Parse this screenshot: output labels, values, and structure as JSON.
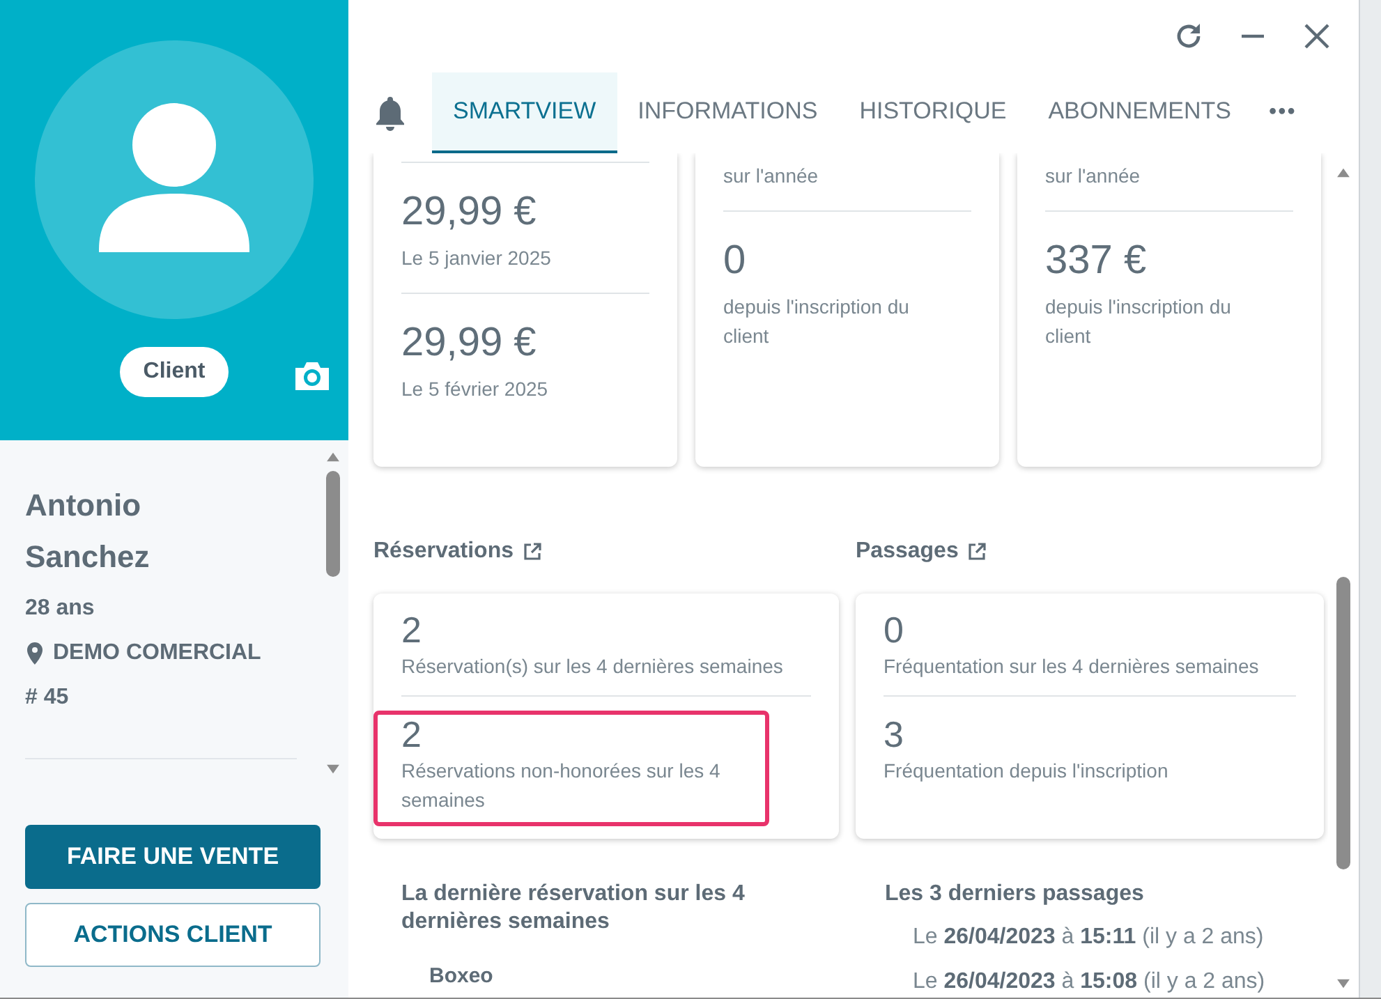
{
  "profile": {
    "badge": "Client",
    "first_name": "Antonio",
    "last_name": "Sanchez",
    "age": "28 ans",
    "location": "DEMO COMERCIAL",
    "number": "# 45"
  },
  "actions": [
    {
      "label": "FAIRE UNE VENTE",
      "kind": "primary"
    },
    {
      "label": "ACTIONS CLIENT",
      "kind": "outline"
    }
  ],
  "tabs": [
    {
      "label": "SMARTVIEW",
      "selected": true
    },
    {
      "label": "INFORMATIONS",
      "selected": false
    },
    {
      "label": "HISTORIQUE",
      "selected": false
    },
    {
      "label": "ABONNEMENTS",
      "selected": false
    }
  ],
  "more_tabs": "•••",
  "summary_cards": [
    {
      "items": [
        {
          "value": "29,99 €",
          "caption": "Le 5 janvier 2025"
        },
        {
          "value": "29,99 €",
          "caption": "Le 5 février 2025"
        }
      ]
    },
    {
      "items": [
        {
          "caption": "sur l'année"
        },
        {
          "value": "0",
          "caption": "depuis l'inscription du client"
        }
      ]
    },
    {
      "items": [
        {
          "caption": "sur l'année"
        },
        {
          "value": "337 €",
          "caption": "depuis l'inscription du client"
        }
      ]
    }
  ],
  "sections": [
    {
      "title": "Réservations",
      "items": [
        {
          "value": "2",
          "caption": "Réservation(s) sur les 4 dernières semaines",
          "highlighted": false
        },
        {
          "value": "2",
          "caption": "Réservations non-honorées sur les 4 semaines",
          "highlighted": true
        }
      ]
    },
    {
      "title": "Passages",
      "items": [
        {
          "value": "0",
          "caption": "Fréquentation sur les 4 dernières semaines",
          "highlighted": false
        },
        {
          "value": "3",
          "caption": "Fréquentation depuis l'inscription",
          "highlighted": false
        }
      ]
    }
  ],
  "last_booking": {
    "title": "La dernière réservation sur les 4 dernières semaines",
    "activity": "Boxeo"
  },
  "last_visits": {
    "title": "Les 3 derniers passages",
    "entries": [
      "Le **26/04/2023** à **15:11** (il y a 2 ans)",
      "Le **26/04/2023** à **15:08** (il y a 2 ans)"
    ]
  }
}
